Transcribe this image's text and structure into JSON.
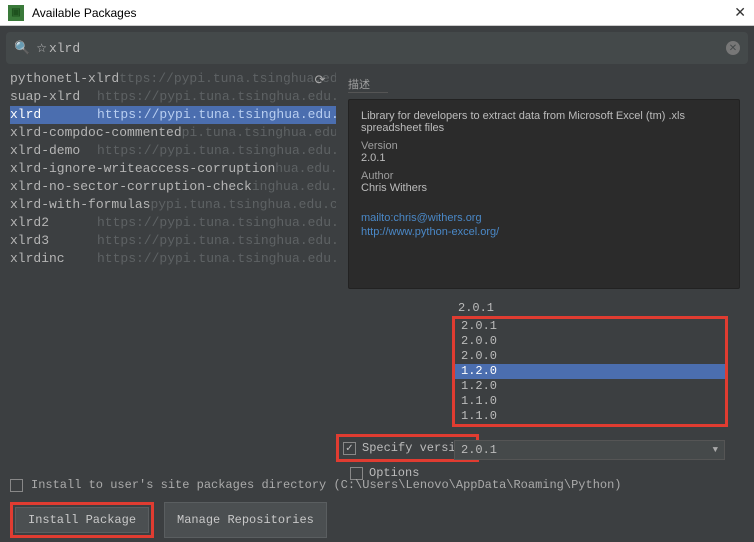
{
  "window": {
    "title": "Available Packages"
  },
  "search": {
    "prefix": "☆",
    "value": "xlrd"
  },
  "packages": [
    {
      "name": "pythonetl-xlrd",
      "url": "ttps://pypi.tuna.tsinghua.edu.cn/simple/",
      "selected": false
    },
    {
      "name": "suap-xlrd",
      "url": "https://pypi.tuna.tsinghua.edu.cn/simple/",
      "selected": false,
      "namePad": 87
    },
    {
      "name": "xlrd",
      "url": "https://pypi.tuna.tsinghua.edu.cn/simple/",
      "selected": true,
      "namePad": 87
    },
    {
      "name": "xlrd-compdoc-commented",
      "url": "pi.tuna.tsinghua.edu.cn/simple/",
      "selected": false
    },
    {
      "name": "xlrd-demo",
      "url": "https://pypi.tuna.tsinghua.edu.cn/simple/",
      "selected": false,
      "namePad": 87
    },
    {
      "name": "xlrd-ignore-writeaccess-corruption",
      "url": "hua.edu.cn/simple/",
      "selected": false
    },
    {
      "name": "xlrd-no-sector-corruption-check",
      "url": "inghua.edu.cn/simple/",
      "selected": false
    },
    {
      "name": "xlrd-with-formulas",
      "url": "pypi.tuna.tsinghua.edu.cn/simple/",
      "selected": false
    },
    {
      "name": "xlrd2",
      "url": "https://pypi.tuna.tsinghua.edu.cn/simple/",
      "selected": false,
      "namePad": 87
    },
    {
      "name": "xlrd3",
      "url": "https://pypi.tuna.tsinghua.edu.cn/simple/",
      "selected": false,
      "namePad": 87
    },
    {
      "name": "xlrdinc",
      "url": "https://pypi.tuna.tsinghua.edu.cn/simple/",
      "selected": false,
      "namePad": 87
    }
  ],
  "description": {
    "header": "描述",
    "summary": "Library for developers to extract data from Microsoft Excel (tm) .xls spreadsheet files",
    "version_label": "Version",
    "version": "2.0.1",
    "author_label": "Author",
    "author": "Chris Withers",
    "links": [
      "mailto:chris@withers.org",
      "http://www.python-excel.org/"
    ]
  },
  "version_overflow": [
    "2.0.1"
  ],
  "version_list": [
    "2.0.1",
    "2.0.0",
    "2.0.0",
    "1.2.0",
    "1.2.0",
    "1.1.0",
    "1.1.0"
  ],
  "version_selected_index": 3,
  "specify": {
    "label": "Specify version",
    "checked": true,
    "value": "2.0.1"
  },
  "options": {
    "label": "Options",
    "checked": false
  },
  "install_to_user": {
    "label": "Install to user's site packages directory (C:\\Users\\Lenovo\\AppData\\Roaming\\Python)",
    "checked": false
  },
  "buttons": {
    "install": "Install Package",
    "manage": "Manage Repositories"
  },
  "highlight_color": "#e03c31"
}
